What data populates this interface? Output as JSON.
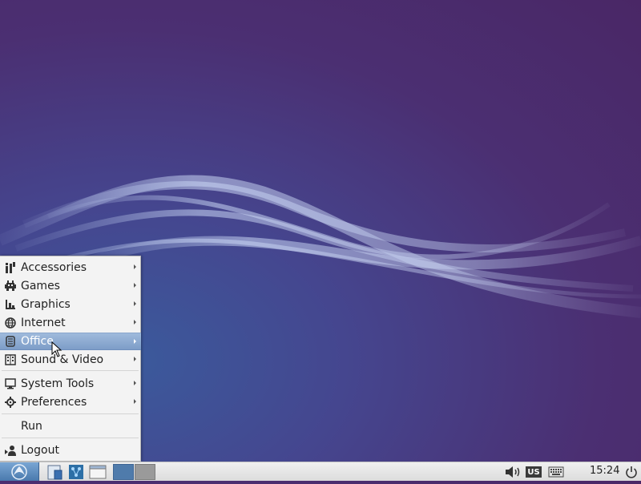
{
  "menu": {
    "items": [
      {
        "label": "Accessories",
        "icon": "accessories-icon",
        "submenu": true
      },
      {
        "label": "Games",
        "icon": "games-icon",
        "submenu": true
      },
      {
        "label": "Graphics",
        "icon": "graphics-icon",
        "submenu": true
      },
      {
        "label": "Internet",
        "icon": "internet-icon",
        "submenu": true
      },
      {
        "label": "Office",
        "icon": "office-icon",
        "submenu": true,
        "active": true
      },
      {
        "label": "Sound & Video",
        "icon": "sound-video-icon",
        "submenu": true
      },
      {
        "label": "System Tools",
        "icon": "system-tools-icon",
        "submenu": true
      },
      {
        "label": "Preferences",
        "icon": "preferences-icon",
        "submenu": true
      },
      {
        "label": "Run",
        "icon": "",
        "submenu": false
      },
      {
        "label": "Logout",
        "icon": "logout-icon",
        "submenu": false
      }
    ]
  },
  "taskbar": {
    "keyboard_layout": "US",
    "clock": "15:24",
    "icons": [
      "start-menu-icon",
      "file-manager-icon",
      "network-icon",
      "show-desktop-icon",
      "volume-icon",
      "keyboard-icon",
      "power-icon"
    ]
  },
  "colors": {
    "accent": "#7d9dc8",
    "desktop_bg": "#4b2f72",
    "menu_bg": "#f3f3f3"
  }
}
